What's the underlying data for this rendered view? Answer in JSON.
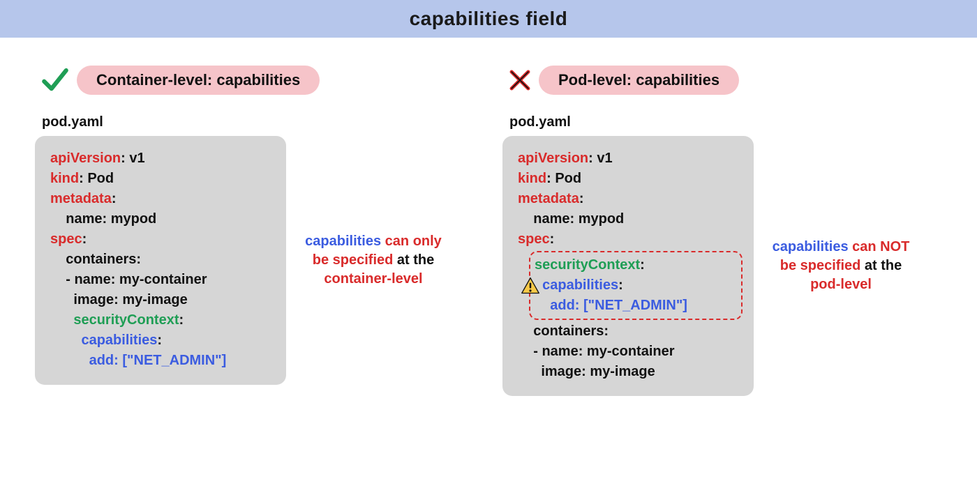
{
  "header": {
    "title": "capabilities field"
  },
  "left": {
    "badge": "Container-level: capabilities",
    "file": "pod.yaml",
    "code": {
      "apiVersion_key": "apiVersion",
      "apiVersion_val": ": v1",
      "kind_key": "kind",
      "kind_val": ": Pod",
      "metadata_key": "metadata",
      "metadata_colon": ":",
      "name_line": "    name: mypod",
      "spec_key": "spec",
      "spec_colon": ":",
      "containers_line": "    containers:",
      "cname_line": "    - name: my-container",
      "image_line": "      image: my-image",
      "seccontext_indent": "      ",
      "seccontext_key": "securityContext",
      "seccontext_colon": ":",
      "caps_indent": "        ",
      "caps_key": "capabilities",
      "caps_colon": ":",
      "add_indent": "          ",
      "add_key": "add",
      "add_val": ": [\"NET_ADMIN\"]"
    },
    "aside": {
      "p1a": "capabilities ",
      "p1b": "can only",
      "p2a": "be specified ",
      "p2b": "at the",
      "p3": "container-level"
    }
  },
  "right": {
    "badge": "Pod-level: capabilities",
    "file": "pod.yaml",
    "code": {
      "apiVersion_key": "apiVersion",
      "apiVersion_val": ": v1",
      "kind_key": "kind",
      "kind_val": ": Pod",
      "metadata_key": "metadata",
      "metadata_colon": ":",
      "name_line": "    name: mypod",
      "spec_key": "spec",
      "spec_colon": ":",
      "seccontext_key": "securityContext",
      "seccontext_colon": ":",
      "caps_indent": "  ",
      "caps_key": "capabilities",
      "caps_colon": ":",
      "add_indent": "    ",
      "add_key": "add",
      "add_val": ": [\"NET_ADMIN\"]",
      "containers_line": "    containers:",
      "cname_line": "    - name: my-container",
      "image_line": "      image: my-image"
    },
    "aside": {
      "p1a": "capabilities ",
      "p1b": "can NOT",
      "p2a": "be specified ",
      "p2b": "at the",
      "p3": "pod-level"
    }
  }
}
